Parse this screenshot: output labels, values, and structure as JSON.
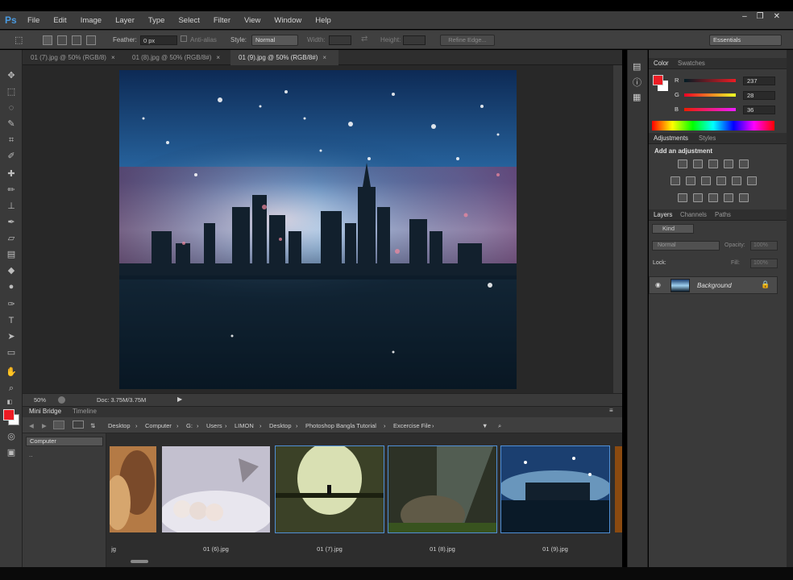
{
  "app": {
    "logo": "Ps",
    "menu": [
      "File",
      "Edit",
      "Image",
      "Layer",
      "Type",
      "Select",
      "Filter",
      "View",
      "Window",
      "Help"
    ],
    "window_controls": [
      "–",
      "❐",
      "✕"
    ]
  },
  "options_bar": {
    "feather_label": "Feather:",
    "feather_value": "0 px",
    "antialias_label": "Anti-alias",
    "style_label": "Style:",
    "style_value": "Normal",
    "width_label": "Width:",
    "height_label": "Height:",
    "refine_edge": "Refine Edge...",
    "workspace": "Essentials"
  },
  "document_tabs": [
    {
      "label": "01 (7).jpg @ 50% (RGB/8)",
      "active": false
    },
    {
      "label": "01 (8).jpg @ 50% (RGB/8#)",
      "active": false
    },
    {
      "label": "01 (9).jpg @ 50% (RGB/8#)",
      "active": true
    }
  ],
  "status": {
    "zoom": "50%",
    "doc": "Doc: 3.75M/3.75M"
  },
  "mini_bridge": {
    "tabs": [
      "Mini Bridge",
      "Timeline"
    ],
    "breadcrumbs": [
      "Desktop",
      "Computer",
      "G:",
      "Users",
      "LIMON",
      "Desktop",
      "Photoshop Bangla Tutorial",
      "Excercise File"
    ],
    "left_select": "Computer",
    "left_item": "..",
    "thumbnails": [
      {
        "label": "01 (5).jpg",
        "selected": false
      },
      {
        "label": "01 (6).jpg",
        "selected": false
      },
      {
        "label": "01 (7).jpg",
        "selected": true
      },
      {
        "label": "01 (8).jpg",
        "selected": true
      },
      {
        "label": "01 (9).jpg",
        "selected": true
      }
    ]
  },
  "color_panel": {
    "tabs": [
      "Color",
      "Swatches"
    ],
    "r_label": "R",
    "r_value": "237",
    "g_label": "G",
    "g_value": "28",
    "b_label": "B",
    "b_value": "36",
    "foreground": "#ed1c24"
  },
  "adjustments_panel": {
    "tabs": [
      "Adjustments",
      "Styles"
    ],
    "title": "Add an adjustment"
  },
  "layers_panel": {
    "tabs": [
      "Layers",
      "Channels",
      "Paths"
    ],
    "kind": "Kind",
    "blend_mode": "Normal",
    "opacity_label": "Opacity:",
    "opacity_value": "100%",
    "lock_label": "Lock:",
    "fill_label": "Fill:",
    "fill_value": "100%",
    "layer_name": "Background"
  }
}
